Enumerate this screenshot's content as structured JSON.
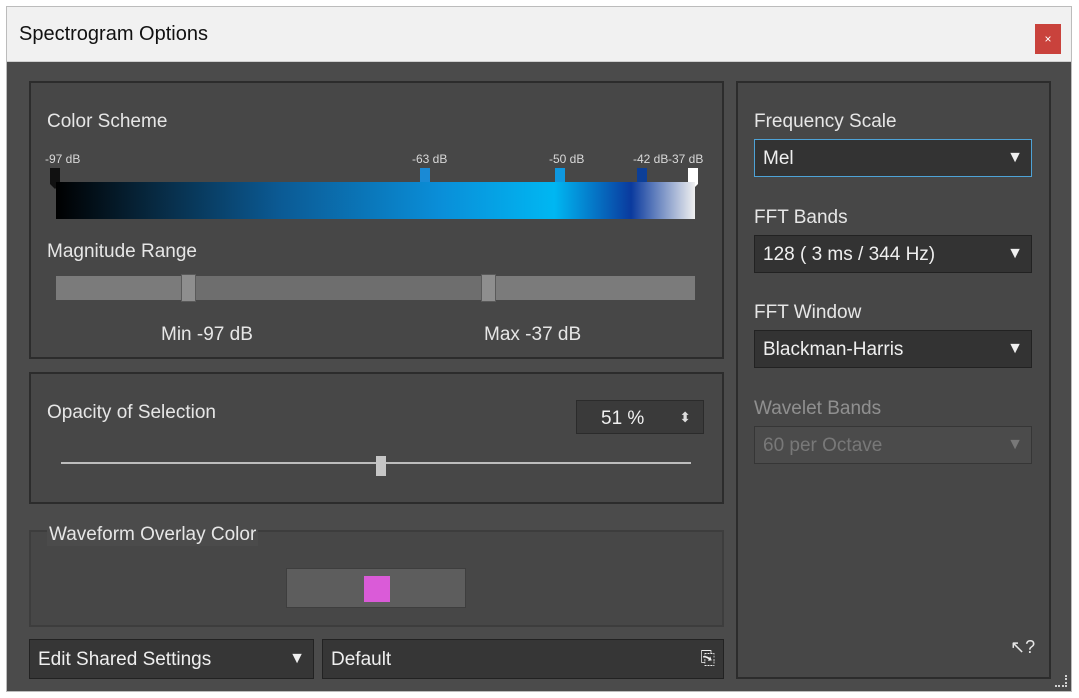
{
  "window": {
    "title": "Spectrogram Options",
    "close_label": "×"
  },
  "color_scheme": {
    "label": "Color Scheme",
    "markers": [
      {
        "label": "-97 dB",
        "color": "#111111"
      },
      {
        "label": "-63 dB",
        "color": "#1a8ad5"
      },
      {
        "label": "-50 dB",
        "color": "#0f98e0"
      },
      {
        "label": "-42 dB",
        "color": "#0c3f98"
      },
      {
        "label": "-37 dB",
        "color": "#ffffff"
      }
    ]
  },
  "magnitude_range": {
    "label": "Magnitude Range",
    "min_label": "Min -97 dB",
    "max_label": "Max -37 dB"
  },
  "opacity": {
    "label": "Opacity of Selection",
    "value": "51 %",
    "stepper_icon": "⬍"
  },
  "waveform": {
    "label": "Waveform Overlay Color",
    "color": "#da5bd8"
  },
  "footer": {
    "shared_settings_label": "Edit Shared Settings",
    "preset_label": "Default",
    "shared_arrow": "▼",
    "preset_icon": "⎘"
  },
  "right": {
    "frequency_scale_label": "Frequency Scale",
    "frequency_scale_value": "Mel",
    "fft_bands_label": "FFT Bands",
    "fft_bands_value": "128    ( 3 ms / 344 Hz)",
    "fft_window_label": "FFT Window",
    "fft_window_value": "Blackman-Harris",
    "wavelet_label": "Wavelet Bands",
    "wavelet_value": "60 per Octave",
    "help_icon": "↖?"
  },
  "common": {
    "dropdown_arrow": "▼"
  }
}
